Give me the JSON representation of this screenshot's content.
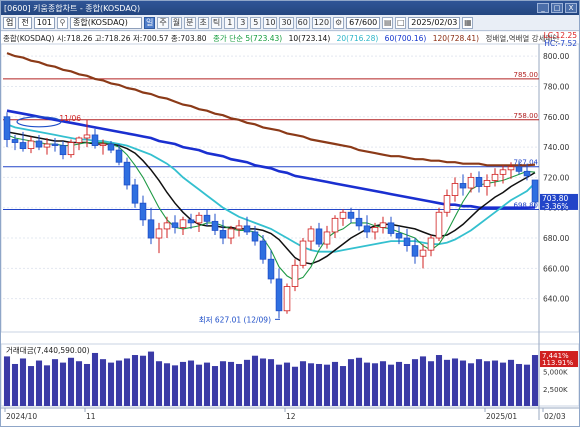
{
  "window": {
    "title": "[0600] 키움종합차트 - 종합(KOSDAQ)",
    "controls": [
      "_",
      "□",
      "X"
    ]
  },
  "toolbar": {
    "selectors": [
      "업",
      "전"
    ],
    "code": "101",
    "name": "종합(KOSDAQ)",
    "periods": [
      "일",
      "주",
      "월",
      "분",
      "초",
      "틱"
    ],
    "active_period": "일",
    "intervals": [
      "1",
      "3",
      "5",
      "10",
      "30",
      "60",
      "120"
    ],
    "count": "67/600",
    "date": "2025/02/03"
  },
  "header": {
    "ohlc": "종합(KOSDAQ) 시:718.26 고:718.26 저:700.57 종:703.80",
    "ma5": "종가 단순 5(723.43)",
    "ma10": "10(723.14)",
    "ma20": "20(716.28)",
    "ma60": "60(700.16)",
    "ma120": "120(728.41)",
    "pattern": "정배열,역배열 강세패턴",
    "lc": "LC:12.25",
    "hc": "HC:-7.52"
  },
  "price_axis": {
    "ticks": [
      "800.00",
      "780.00",
      "760.00",
      "740.00",
      "720.00",
      "700.00",
      "680.00",
      "660.00",
      "640.00"
    ],
    "tick_values": [
      800,
      780,
      760,
      740,
      720,
      700,
      680,
      660,
      640
    ],
    "min": 618,
    "max": 808
  },
  "levels": [
    {
      "label": "785.00",
      "value": 785,
      "color": "#b22222"
    },
    {
      "label": "758.00",
      "value": 758,
      "color": "#b22222"
    },
    {
      "label": "727.04",
      "value": 727.04,
      "color": "#2245c8"
    },
    {
      "label": "698.80",
      "value": 698.8,
      "color": "#2245c8"
    }
  ],
  "current": {
    "price_label": "703.80",
    "change_label": "-3.36%",
    "price": 703.8
  },
  "low_annotation": {
    "text": "최저 627.01 (12/09)",
    "value": 627.01
  },
  "top_annotation": {
    "text": "11/06",
    "value": 758
  },
  "volume": {
    "label": "거래대금(7,440,590.00)",
    "current_label": "7,441%",
    "change_label": "113.91%",
    "ticks": [
      "5,000K",
      "2,500K"
    ],
    "tick_values": [
      5000,
      2500
    ],
    "max": 9000,
    "color": "#3a3aa6",
    "values": [
      7200,
      6100,
      6900,
      5800,
      6600,
      5900,
      6800,
      6300,
      7000,
      6500,
      6100,
      7700,
      6800,
      6300,
      6600,
      6900,
      7400,
      7300,
      7900,
      6500,
      6200,
      5900,
      6400,
      6600,
      6000,
      6300,
      5800,
      6500,
      6400,
      6100,
      6700,
      7300,
      6900,
      6800,
      6000,
      6300,
      5700,
      6500,
      6200,
      6100,
      6000,
      6400,
      5800,
      6800,
      7000,
      6300,
      6200,
      6500,
      6000,
      6400,
      6100,
      6800,
      7200,
      6500,
      7400,
      6700,
      6900,
      6600,
      6200,
      6800,
      6500,
      6600,
      6300,
      6700,
      6100,
      6000,
      7400
    ]
  },
  "date_axis": {
    "labels": [
      "2024/10",
      "11",
      "12",
      "2025/01",
      "02",
      "02/03"
    ],
    "positions": [
      0,
      10,
      35,
      60,
      87,
      88
    ]
  },
  "chart_data": {
    "type": "candlestick",
    "title": "종합(KOSDAQ)",
    "candles": [
      {
        "o": 760,
        "h": 763,
        "l": 740,
        "c": 745
      },
      {
        "o": 745,
        "h": 748,
        "l": 738,
        "c": 743
      },
      {
        "o": 743,
        "h": 750,
        "l": 737,
        "c": 739
      },
      {
        "o": 739,
        "h": 747,
        "l": 736,
        "c": 744
      },
      {
        "o": 744,
        "h": 748,
        "l": 738,
        "c": 740
      },
      {
        "o": 740,
        "h": 746,
        "l": 735,
        "c": 742
      },
      {
        "o": 742,
        "h": 746,
        "l": 737,
        "c": 741
      },
      {
        "o": 741,
        "h": 744,
        "l": 732,
        "c": 735
      },
      {
        "o": 735,
        "h": 745,
        "l": 733,
        "c": 743
      },
      {
        "o": 743,
        "h": 747,
        "l": 738,
        "c": 746
      },
      {
        "o": 746,
        "h": 758,
        "l": 740,
        "c": 748
      },
      {
        "o": 748,
        "h": 752,
        "l": 739,
        "c": 741
      },
      {
        "o": 741,
        "h": 745,
        "l": 735,
        "c": 742
      },
      {
        "o": 742,
        "h": 744,
        "l": 736,
        "c": 738
      },
      {
        "o": 738,
        "h": 742,
        "l": 728,
        "c": 730
      },
      {
        "o": 730,
        "h": 733,
        "l": 712,
        "c": 715
      },
      {
        "o": 715,
        "h": 719,
        "l": 700,
        "c": 703
      },
      {
        "o": 703,
        "h": 708,
        "l": 688,
        "c": 692
      },
      {
        "o": 692,
        "h": 700,
        "l": 676,
        "c": 680
      },
      {
        "o": 680,
        "h": 690,
        "l": 670,
        "c": 686
      },
      {
        "o": 686,
        "h": 694,
        "l": 680,
        "c": 690
      },
      {
        "o": 690,
        "h": 695,
        "l": 683,
        "c": 687
      },
      {
        "o": 687,
        "h": 694,
        "l": 682,
        "c": 692
      },
      {
        "o": 692,
        "h": 696,
        "l": 686,
        "c": 690
      },
      {
        "o": 690,
        "h": 697,
        "l": 684,
        "c": 695
      },
      {
        "o": 695,
        "h": 699,
        "l": 688,
        "c": 691
      },
      {
        "o": 691,
        "h": 696,
        "l": 682,
        "c": 685
      },
      {
        "o": 685,
        "h": 692,
        "l": 676,
        "c": 680
      },
      {
        "o": 680,
        "h": 688,
        "l": 676,
        "c": 686
      },
      {
        "o": 686,
        "h": 692,
        "l": 681,
        "c": 688
      },
      {
        "o": 688,
        "h": 694,
        "l": 682,
        "c": 684
      },
      {
        "o": 684,
        "h": 688,
        "l": 675,
        "c": 678
      },
      {
        "o": 678,
        "h": 682,
        "l": 663,
        "c": 666
      },
      {
        "o": 666,
        "h": 672,
        "l": 650,
        "c": 653
      },
      {
        "o": 653,
        "h": 660,
        "l": 627.01,
        "c": 632
      },
      {
        "o": 632,
        "h": 650,
        "l": 630,
        "c": 648
      },
      {
        "o": 648,
        "h": 666,
        "l": 645,
        "c": 662
      },
      {
        "o": 662,
        "h": 680,
        "l": 660,
        "c": 678
      },
      {
        "o": 678,
        "h": 688,
        "l": 672,
        "c": 686
      },
      {
        "o": 686,
        "h": 690,
        "l": 674,
        "c": 676
      },
      {
        "o": 676,
        "h": 688,
        "l": 673,
        "c": 684
      },
      {
        "o": 684,
        "h": 695,
        "l": 680,
        "c": 693
      },
      {
        "o": 693,
        "h": 699,
        "l": 688,
        "c": 697
      },
      {
        "o": 697,
        "h": 700,
        "l": 690,
        "c": 693
      },
      {
        "o": 693,
        "h": 699,
        "l": 685,
        "c": 688
      },
      {
        "o": 688,
        "h": 695,
        "l": 680,
        "c": 684
      },
      {
        "o": 684,
        "h": 690,
        "l": 679,
        "c": 687
      },
      {
        "o": 687,
        "h": 694,
        "l": 683,
        "c": 690
      },
      {
        "o": 690,
        "h": 694,
        "l": 681,
        "c": 683
      },
      {
        "o": 683,
        "h": 688,
        "l": 676,
        "c": 680
      },
      {
        "o": 680,
        "h": 686,
        "l": 671,
        "c": 675
      },
      {
        "o": 675,
        "h": 680,
        "l": 663,
        "c": 668
      },
      {
        "o": 668,
        "h": 676,
        "l": 660,
        "c": 672
      },
      {
        "o": 672,
        "h": 682,
        "l": 668,
        "c": 680
      },
      {
        "o": 680,
        "h": 700,
        "l": 678,
        "c": 697
      },
      {
        "o": 697,
        "h": 712,
        "l": 694,
        "c": 708
      },
      {
        "o": 708,
        "h": 720,
        "l": 704,
        "c": 716
      },
      {
        "o": 716,
        "h": 722,
        "l": 708,
        "c": 713
      },
      {
        "o": 713,
        "h": 723,
        "l": 710,
        "c": 720
      },
      {
        "o": 720,
        "h": 724,
        "l": 710,
        "c": 714
      },
      {
        "o": 714,
        "h": 722,
        "l": 708,
        "c": 718
      },
      {
        "o": 718,
        "h": 726,
        "l": 714,
        "c": 722
      },
      {
        "o": 722,
        "h": 728,
        "l": 716,
        "c": 725
      },
      {
        "o": 725,
        "h": 730,
        "l": 719,
        "c": 727
      },
      {
        "o": 727,
        "h": 731,
        "l": 722,
        "c": 724
      },
      {
        "o": 724,
        "h": 729,
        "l": 718,
        "c": 721
      },
      {
        "o": 718.26,
        "h": 718.26,
        "l": 700.57,
        "c": 703.8
      }
    ],
    "ma5": [
      748,
      746,
      745,
      744,
      743,
      742,
      742,
      741,
      741,
      742,
      743,
      743,
      743,
      742,
      740,
      735,
      728,
      720,
      710,
      700,
      692,
      687,
      686,
      687,
      688,
      690,
      690,
      688,
      686,
      685,
      685,
      684,
      680,
      672,
      661,
      655,
      652,
      654,
      661,
      672,
      680,
      684,
      686,
      690,
      690,
      690,
      688,
      687,
      686,
      684,
      682,
      680,
      675,
      672,
      676,
      684,
      694,
      704,
      712,
      715,
      716,
      717,
      718,
      720,
      722,
      724,
      723.43
    ],
    "ma10": [
      750,
      749,
      748,
      747,
      746,
      745,
      744,
      744,
      743,
      743,
      743,
      742,
      742,
      742,
      741,
      739,
      736,
      731,
      725,
      718,
      710,
      703,
      697,
      692,
      689,
      688,
      688,
      687,
      687,
      686,
      686,
      686,
      685,
      683,
      679,
      673,
      667,
      664,
      663,
      665,
      668,
      672,
      676,
      680,
      683,
      686,
      688,
      689,
      689,
      688,
      687,
      686,
      684,
      682,
      681,
      682,
      685,
      689,
      694,
      699,
      703,
      707,
      710,
      714,
      717,
      720,
      723.14
    ],
    "ma20": [
      755,
      753,
      752,
      751,
      750,
      749,
      748,
      747,
      746,
      745,
      745,
      744,
      744,
      743,
      742,
      741,
      739,
      737,
      735,
      732,
      729,
      725,
      720,
      716,
      712,
      708,
      704,
      700,
      697,
      694,
      692,
      690,
      688,
      686,
      683,
      680,
      677,
      674,
      672,
      671,
      671,
      671,
      672,
      673,
      674,
      675,
      676,
      677,
      678,
      678,
      678,
      678,
      677,
      676,
      676,
      677,
      679,
      682,
      685,
      689,
      693,
      697,
      701,
      705,
      708,
      711,
      716.28
    ],
    "ma60": [
      764,
      763,
      762,
      761,
      760,
      759,
      758,
      757,
      756,
      755,
      754,
      753,
      752,
      751,
      750,
      749,
      748,
      747,
      746,
      744,
      743,
      742,
      740,
      739,
      738,
      736,
      735,
      734,
      732,
      731,
      730,
      728,
      727,
      726,
      724,
      723,
      721,
      720,
      719,
      718,
      717,
      716,
      715,
      714,
      713,
      712,
      711,
      710,
      709,
      708,
      707,
      706,
      705,
      704,
      703,
      702,
      702,
      701,
      701,
      700,
      700,
      700,
      700,
      700,
      700,
      700,
      700.16
    ],
    "ma120": [
      802,
      800,
      799,
      797,
      796,
      794,
      793,
      791,
      790,
      788,
      787,
      785,
      784,
      782,
      781,
      779,
      778,
      776,
      775,
      773,
      772,
      770,
      768,
      767,
      765,
      764,
      762,
      761,
      759,
      758,
      756,
      755,
      753,
      752,
      751,
      749,
      748,
      747,
      745,
      744,
      743,
      742,
      741,
      740,
      738,
      737,
      736,
      735,
      734,
      734,
      733,
      732,
      732,
      731,
      731,
      730,
      730,
      729,
      729,
      729,
      728,
      728,
      728,
      728,
      728,
      728,
      728.41
    ]
  }
}
